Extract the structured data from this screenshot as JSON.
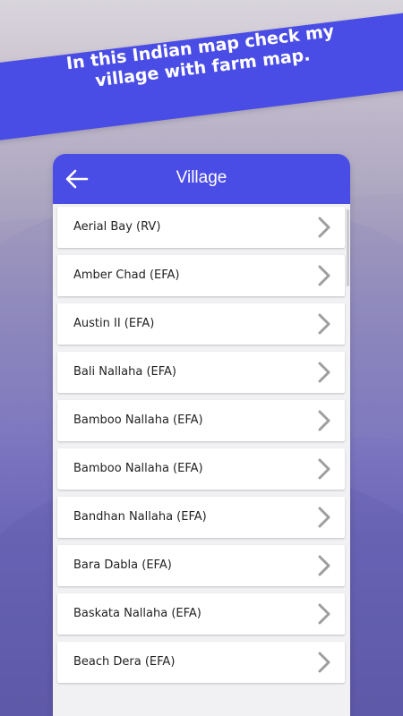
{
  "banner": {
    "line1": "In this Indian map check my",
    "line2": "village with farm map."
  },
  "appbar": {
    "title": "Village",
    "back_icon": "arrow-left-icon"
  },
  "colors": {
    "accent": "#4a4ce6",
    "list_bg": "#f1f1f3",
    "chevron": "#9e9e9e"
  },
  "villages": [
    {
      "label": "Aerial Bay (RV)"
    },
    {
      "label": "Amber Chad (EFA)"
    },
    {
      "label": "Austin II (EFA)"
    },
    {
      "label": "Bali Nallaha (EFA)"
    },
    {
      "label": "Bamboo Nallaha (EFA)"
    },
    {
      "label": "Bamboo Nallaha (EFA)"
    },
    {
      "label": "Bandhan Nallaha (EFA)"
    },
    {
      "label": "Bara Dabla (EFA)"
    },
    {
      "label": "Baskata Nallaha (EFA)"
    },
    {
      "label": "Beach Dera (EFA)"
    }
  ]
}
